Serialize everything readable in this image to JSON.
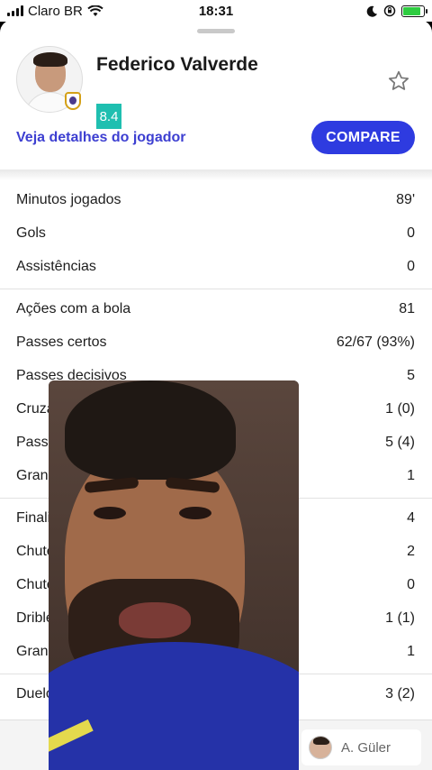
{
  "status_bar": {
    "carrier": "Claro BR",
    "time": "18:31",
    "battery_percent": 85
  },
  "player": {
    "name": "Federico Valverde",
    "rating": "8.4",
    "details_link": "Veja detalhes do jogador",
    "compare_button": "COMPARE",
    "rating_color": "#1fbfb0",
    "accent_color": "#2e3be0"
  },
  "stats": {
    "groups": [
      [
        {
          "label": "Minutos jogados",
          "value": "89'"
        },
        {
          "label": "Gols",
          "value": "0"
        },
        {
          "label": "Assistências",
          "value": "0"
        }
      ],
      [
        {
          "label": "Ações com a bola",
          "value": "81"
        },
        {
          "label": "Passes certos",
          "value": "62/67 (93%)"
        },
        {
          "label": "Passes decisivos",
          "value": "5"
        },
        {
          "label": "Cruzamentos",
          "value": "1 (0)"
        },
        {
          "label": "Passes longos",
          "value": "5 (4)"
        },
        {
          "label": "Grandes chances criadas",
          "value": "1"
        }
      ],
      [
        {
          "label": "Finalizações",
          "value": "4"
        },
        {
          "label": "Chutes no gol",
          "value": "2"
        },
        {
          "label": "Chutes bloqueados",
          "value": "0"
        },
        {
          "label": "Dribles (certos)",
          "value": "1 (1)"
        },
        {
          "label": "Grandes chances perdidas",
          "value": "1"
        }
      ],
      [
        {
          "label": "Duelos (ganhos)",
          "value": "3 (2)"
        }
      ]
    ]
  },
  "substitute": {
    "name": "A. Güler"
  }
}
